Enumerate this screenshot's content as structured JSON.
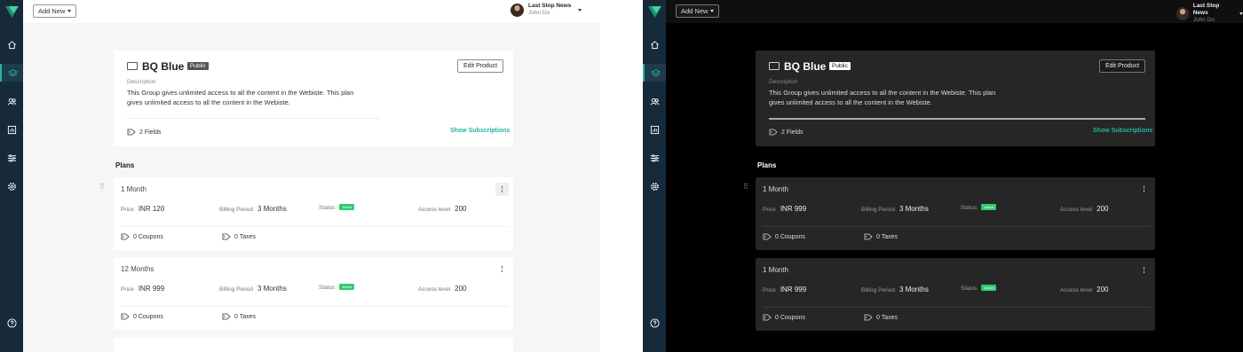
{
  "colors": {
    "sidebar": "#172a3a",
    "accent": "#27b39a",
    "status_active": "#2ecc71"
  },
  "icons": [
    "logo-icon",
    "home-icon",
    "layers-icon",
    "users-icon",
    "report-icon",
    "sliders-icon",
    "gear-icon",
    "help-icon",
    "product-card-icon",
    "tag-icon",
    "kebab-icon",
    "drag-handle-icon"
  ],
  "light": {
    "toolbar": {
      "add_new": "Add New"
    },
    "user": {
      "org": "Last Stop News",
      "name": "John Do"
    },
    "product": {
      "title": "BQ Blue",
      "badge": "Public",
      "edit_label": "Edit Product",
      "description_label": "Description",
      "description": "This Group gives unlimited access to all the content in the Webiste.  This plan gives unlimited access to all the content in the Webiste.",
      "fields": "2 Fields",
      "show_subscriptions": "Show Subscriptions"
    },
    "plans_heading": "Plans",
    "plans": [
      {
        "name": "1 Month",
        "price_label": "Price",
        "price": "INR 120",
        "billing_label": "Billing Period",
        "billing": "3 Months",
        "status_label": "Status",
        "status": "Active",
        "access_label": "Access level",
        "access": "200",
        "coupons": "0 Coupons",
        "taxes": "0 Taxes"
      },
      {
        "name": "12 Months",
        "price_label": "Price",
        "price": "INR 999",
        "billing_label": "Billing Period",
        "billing": "3 Months",
        "status_label": "Status",
        "status": "Active",
        "access_label": "Access level",
        "access": "200",
        "coupons": "0 Coupons",
        "taxes": "0 Taxes"
      }
    ]
  },
  "dark": {
    "toolbar": {
      "add_new": "Add New"
    },
    "user": {
      "org": "Last Stop News",
      "name": "John Do"
    },
    "product": {
      "title": "BQ Blue",
      "badge": "Public",
      "edit_label": "Edit Product",
      "description_label": "Description",
      "description": "This Group gives unlimited access to all the content in the Webiste.  This plan gives unlimited access to all the content in the Webiste.",
      "fields": "2 Fields",
      "show_subscriptions": "Show Subscriptions"
    },
    "plans_heading": "Plans",
    "plans": [
      {
        "name": "1 Month",
        "price_label": "Price",
        "price": "INR 999",
        "billing_label": "Billing Period",
        "billing": "3 Months",
        "status_label": "Status",
        "status": "Active",
        "access_label": "Access level",
        "access": "200",
        "coupons": "0 Coupons",
        "taxes": "0 Taxes"
      },
      {
        "name": "1 Month",
        "price_label": "Price",
        "price": "INR 999",
        "billing_label": "Billing Period",
        "billing": "3 Months",
        "status_label": "Status",
        "status": "Active",
        "access_label": "Access level",
        "access": "200",
        "coupons": "0 Coupons",
        "taxes": "0 Taxes"
      }
    ]
  }
}
